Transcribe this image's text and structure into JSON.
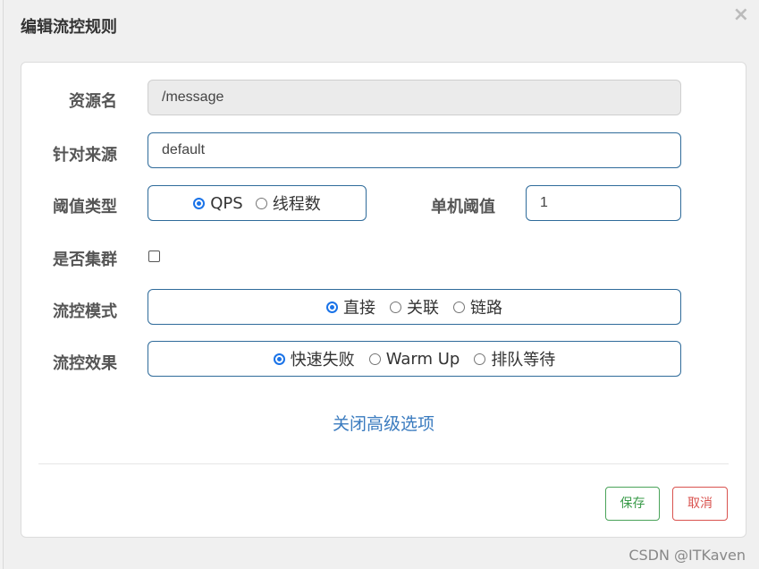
{
  "dialog": {
    "title": "编辑流控规则",
    "close_glyph": "×"
  },
  "form": {
    "resource_label": "资源名",
    "resource_value": "/message",
    "source_label": "针对来源",
    "source_value": "default",
    "threshold_type_label": "阈值类型",
    "threshold_type_options": [
      "QPS",
      "线程数"
    ],
    "threshold_type_selected": "QPS",
    "single_threshold_label": "单机阈值",
    "single_threshold_value": "1",
    "cluster_label": "是否集群",
    "cluster_checked": false,
    "mode_label": "流控模式",
    "mode_options": [
      "直接",
      "关联",
      "链路"
    ],
    "mode_selected": "直接",
    "effect_label": "流控效果",
    "effect_options": [
      "快速失败",
      "Warm Up",
      "排队等待"
    ],
    "effect_selected": "快速失败"
  },
  "advanced_link": "关闭高级选项",
  "buttons": {
    "save": "保存",
    "cancel": "取消"
  },
  "watermark": "CSDN @ITKaven",
  "colors": {
    "input_border": "#2f6b9a",
    "radio_selected": "#1a73e8",
    "link": "#3a7bbf",
    "save": "#3a9b4a",
    "cancel": "#d9534f"
  }
}
